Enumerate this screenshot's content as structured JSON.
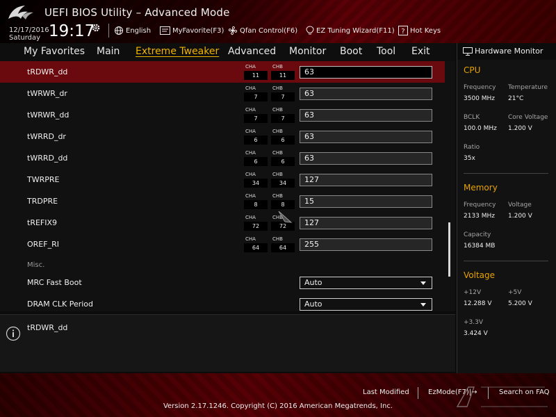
{
  "header": {
    "title": "UEFI BIOS Utility – Advanced Mode",
    "date": "12/17/2016",
    "day": "Saturday",
    "time": "19:17",
    "buttons": [
      {
        "label": "English",
        "icon": "globe-icon"
      },
      {
        "label": "MyFavorite(F3)",
        "icon": "favorite-icon"
      },
      {
        "label": "Qfan Control(F6)",
        "icon": "fan-icon"
      },
      {
        "label": "EZ Tuning Wizard(F11)",
        "icon": "bulb-icon"
      },
      {
        "label": "Hot Keys",
        "icon": "help-icon"
      }
    ]
  },
  "nav": {
    "tabs": [
      "My Favorites",
      "Main",
      "Extreme Tweaker",
      "Advanced",
      "Monitor",
      "Boot",
      "Tool",
      "Exit"
    ],
    "active": "Extreme Tweaker"
  },
  "settings": {
    "channel_labels": {
      "a": "CHA",
      "b": "CHB"
    },
    "rows": [
      {
        "label": "tRDWR_dd",
        "cha": "11",
        "chb": "11",
        "value": "63",
        "selected": true
      },
      {
        "label": "tWRWR_dr",
        "cha": "7",
        "chb": "7",
        "value": "63"
      },
      {
        "label": "tWRWR_dd",
        "cha": "7",
        "chb": "7",
        "value": "63"
      },
      {
        "label": "tWRRD_dr",
        "cha": "6",
        "chb": "6",
        "value": "63"
      },
      {
        "label": "tWRRD_dd",
        "cha": "6",
        "chb": "6",
        "value": "63"
      },
      {
        "label": "TWRPRE",
        "cha": "34",
        "chb": "34",
        "value": "127"
      },
      {
        "label": "TRDPRE",
        "cha": "8",
        "chb": "8",
        "value": "15"
      },
      {
        "label": "tREFIX9",
        "cha": "72",
        "chb": "72",
        "value": "127"
      },
      {
        "label": "OREF_RI",
        "cha": "64",
        "chb": "64",
        "value": "255"
      }
    ],
    "misc_label": "Misc.",
    "selects": [
      {
        "label": "MRC Fast Boot",
        "value": "Auto"
      },
      {
        "label": "DRAM CLK Period",
        "value": "Auto"
      }
    ]
  },
  "help": {
    "title": "tRDWR_dd"
  },
  "hardware_monitor": {
    "title": "Hardware Monitor",
    "cpu": {
      "heading": "CPU",
      "frequency_label": "Frequency",
      "frequency": "3500 MHz",
      "temperature_label": "Temperature",
      "temperature": "21°C",
      "bclk_label": "BCLK",
      "bclk": "100.0 MHz",
      "core_voltage_label": "Core Voltage",
      "core_voltage": "1.200 V",
      "ratio_label": "Ratio",
      "ratio": "35x"
    },
    "memory": {
      "heading": "Memory",
      "frequency_label": "Frequency",
      "frequency": "2133 MHz",
      "voltage_label": "Voltage",
      "voltage": "1.200 V",
      "capacity_label": "Capacity",
      "capacity": "16384 MB"
    },
    "voltage": {
      "heading": "Voltage",
      "v12_label": "+12V",
      "v12": "12.288 V",
      "v5_label": "+5V",
      "v5": "5.200 V",
      "v33_label": "+3.3V",
      "v33": "3.424 V"
    }
  },
  "footer": {
    "last_modified": "Last Modified",
    "ezmode": "EzMode(F7)|→",
    "search": "Search on FAQ",
    "copyright": "Version 2.17.1246. Copyright (C) 2016 American Megatrends, Inc."
  },
  "colors": {
    "accent": "#e8a300",
    "selected_row": "#6a0a0e",
    "brand_red": "#7a0008"
  }
}
